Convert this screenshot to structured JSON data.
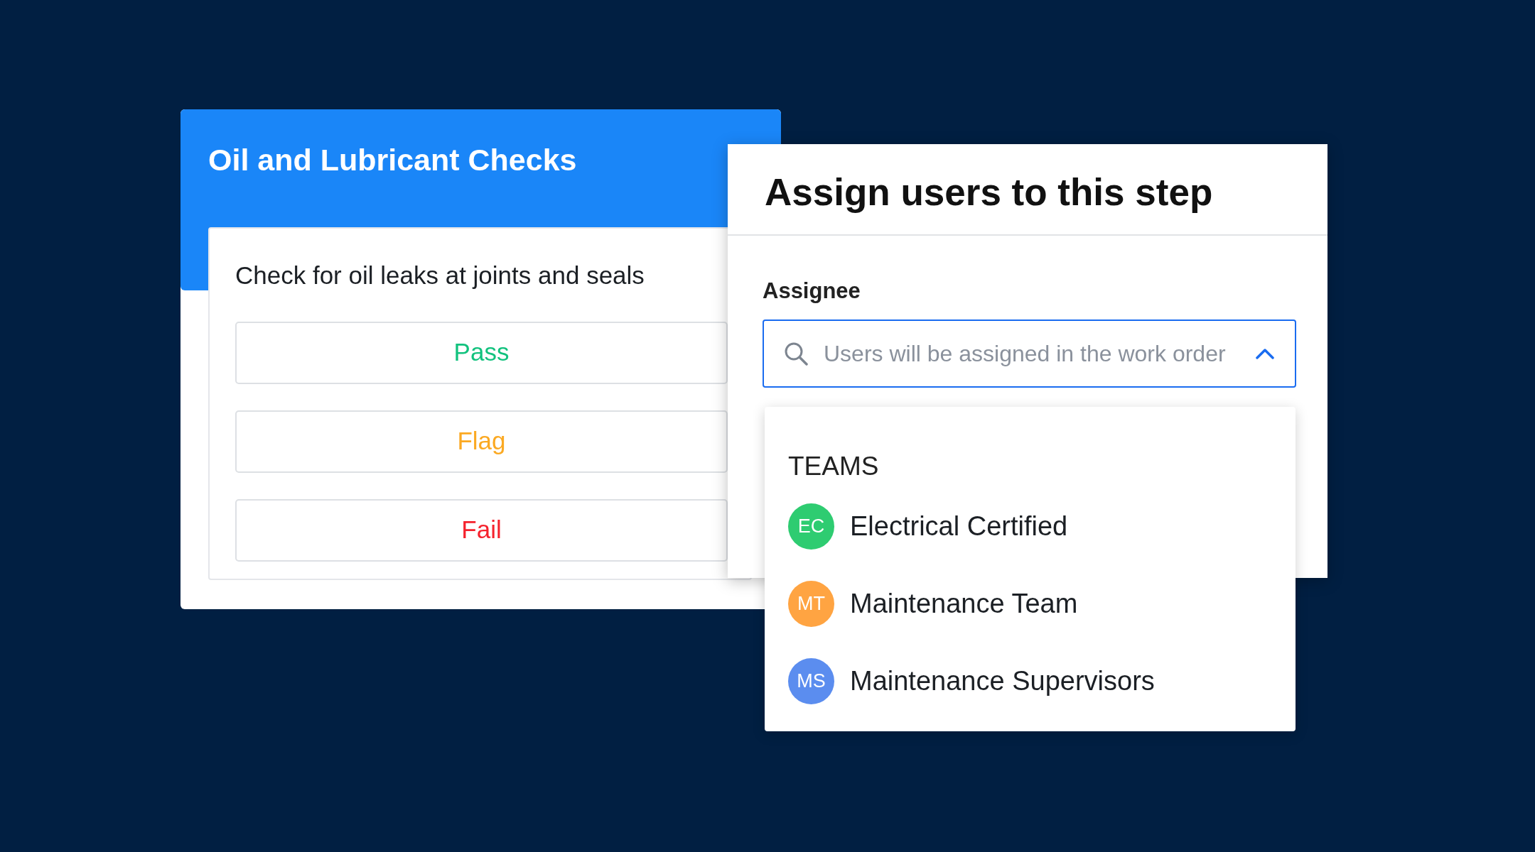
{
  "checklist_card": {
    "title": "Oil and Lubricant Checks",
    "question": "Check for oil leaks at joints and seals",
    "options": [
      {
        "label": "Pass",
        "color": "#12c27e"
      },
      {
        "label": "Flag",
        "color": "#fba922"
      },
      {
        "label": "Fail",
        "color": "#f5222d"
      }
    ]
  },
  "assign_panel": {
    "title": "Assign users to this step",
    "field_label": "Assignee",
    "placeholder": "Users will be assigned in the work order",
    "expanded": true,
    "dropdown": {
      "section": "TEAMS",
      "teams": [
        {
          "initials": "EC",
          "name": "Electrical Certified",
          "color": "#2ecc71"
        },
        {
          "initials": "MT",
          "name": "Maintenance Team",
          "color": "#ffa442"
        },
        {
          "initials": "MS",
          "name": "Maintenance Supervisors",
          "color": "#5b8def"
        }
      ]
    }
  }
}
